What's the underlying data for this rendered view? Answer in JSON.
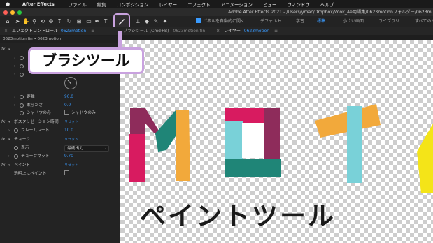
{
  "menubar": {
    "app_name": "After Effects",
    "items": [
      "ファイル",
      "編集",
      "コンポジション",
      "レイヤー",
      "エフェクト",
      "アニメーション",
      "ビュー",
      "ウィンドウ",
      "ヘルプ"
    ]
  },
  "window": {
    "title": "Adobe After Effects 2021 - /Users/ymac/Dropbox/Vook_Ae用語集/0623motionフォルダー/0623m"
  },
  "toolbar": {
    "auto_open_label": "パネルを自動的に開く",
    "workspaces": [
      "デフォルト",
      "学習",
      "標準",
      "小さい画面",
      "ライブラリ",
      "すべてのパ"
    ],
    "active_workspace": "標準"
  },
  "callout": {
    "text": "ブラシツール"
  },
  "effect_panel": {
    "tab_title": "エフェクトコントロール",
    "tab_layer": "0623motion",
    "subheader": "0623motion fin • 0623motion",
    "rows": {
      "hardness_label": "距離",
      "hardness_value": "90.0",
      "softness_label": "柔らかさ",
      "softness_value": "0.0",
      "shadow_only_label": "シャドウのみ",
      "shadow_only_check": "シャドウのみ",
      "posterize_label": "ポスタリゼーション時間",
      "posterize_reset": "リセット",
      "frame_rate_label": "フレームレート",
      "frame_rate_value": "10.0",
      "choke_label": "チョーク",
      "choke_reset": "リセット",
      "display_label": "表示",
      "display_value": "最終出力",
      "choke_matte_label": "チョークマット",
      "choke_matte_value": "9.70",
      "paint_label": "ペイント",
      "paint_reset": "リセット",
      "paint_transparent_label": "透明上にペイント"
    }
  },
  "viewer": {
    "tab1": "ブラシツール (Cmd+B)",
    "tab1_suffix": "0623motion fin",
    "tab2": "レイヤー",
    "tab2_layer": "0623motion"
  },
  "artwork": {
    "caption": "ペイントツール",
    "colors": {
      "crimson": "#d81b60",
      "plum": "#8e2c5b",
      "teal": "#1f8577",
      "orange": "#f2a93b",
      "cyan": "#79d1d8",
      "yellow": "#f4e418"
    }
  }
}
